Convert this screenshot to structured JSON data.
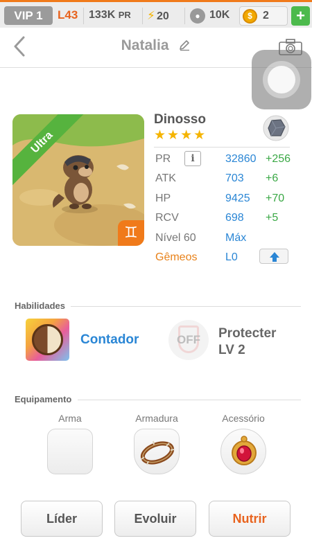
{
  "status": {
    "vip": "VIP 1",
    "level": "L43",
    "pr_value": "133K",
    "pr_unit": "PR",
    "energy": "20",
    "paws": "10K",
    "coins": "2",
    "add": "+"
  },
  "header": {
    "back": "‹",
    "title": "Natalia"
  },
  "creature": {
    "rarity": "Ultra",
    "zodiac": "♊",
    "name": "Dinosso",
    "stars": "★★★★",
    "stats": [
      {
        "label": "PR",
        "value": "32860",
        "bonus": "+256"
      },
      {
        "label": "ATK",
        "value": "703",
        "bonus": "+6"
      },
      {
        "label": "HP",
        "value": "9425",
        "bonus": "+70"
      },
      {
        "label": "RCV",
        "value": "698",
        "bonus": "+5"
      }
    ],
    "level_label": "Nível 60",
    "level_value": "Máx",
    "twins_label": "Gêmeos",
    "twins_value": "L0",
    "info": "i"
  },
  "skills": {
    "title": "Habilidades",
    "skill1": "Contador",
    "off": "OFF",
    "skill2_line1": "Protecter",
    "skill2_line2": "LV 2"
  },
  "equipment": {
    "title": "Equipamento",
    "weapon": "Arma",
    "armor": "Armadura",
    "accessory": "Acessório"
  },
  "actions": {
    "leader": "Líder",
    "evolve": "Evoluir",
    "feed": "Nutrir"
  },
  "colors": {
    "accent": "#f07a1a",
    "value_blue": "#2a86d5",
    "bonus_green": "#3aa845"
  }
}
